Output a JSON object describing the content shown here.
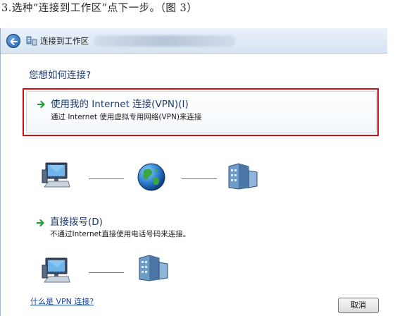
{
  "caption": "3.选种“连接到工作区”点下一步。（图 3）",
  "window": {
    "title": "连接到工作区"
  },
  "question": "您想如何连接?",
  "options": [
    {
      "title": "使用我的 Internet 连接(VPN)(I)",
      "description": "通过 Internet 使用虚拟专用网络(VPN)来连接",
      "highlighted": true,
      "icons": [
        "computer-icon",
        "globe-icon",
        "server-icon"
      ]
    },
    {
      "title": "直接拨号(D)",
      "description": "不通过Internet直接使用电话号码来连接。",
      "icons": [
        "computer-icon",
        "server-icon"
      ]
    }
  ],
  "help_link": "什么是 VPN 连接?",
  "cancel_label": "取消",
  "colors": {
    "highlight": "#cc1111",
    "heading": "#1e3b70",
    "link": "#1a47a6",
    "arrow": "#1f9e3a"
  }
}
